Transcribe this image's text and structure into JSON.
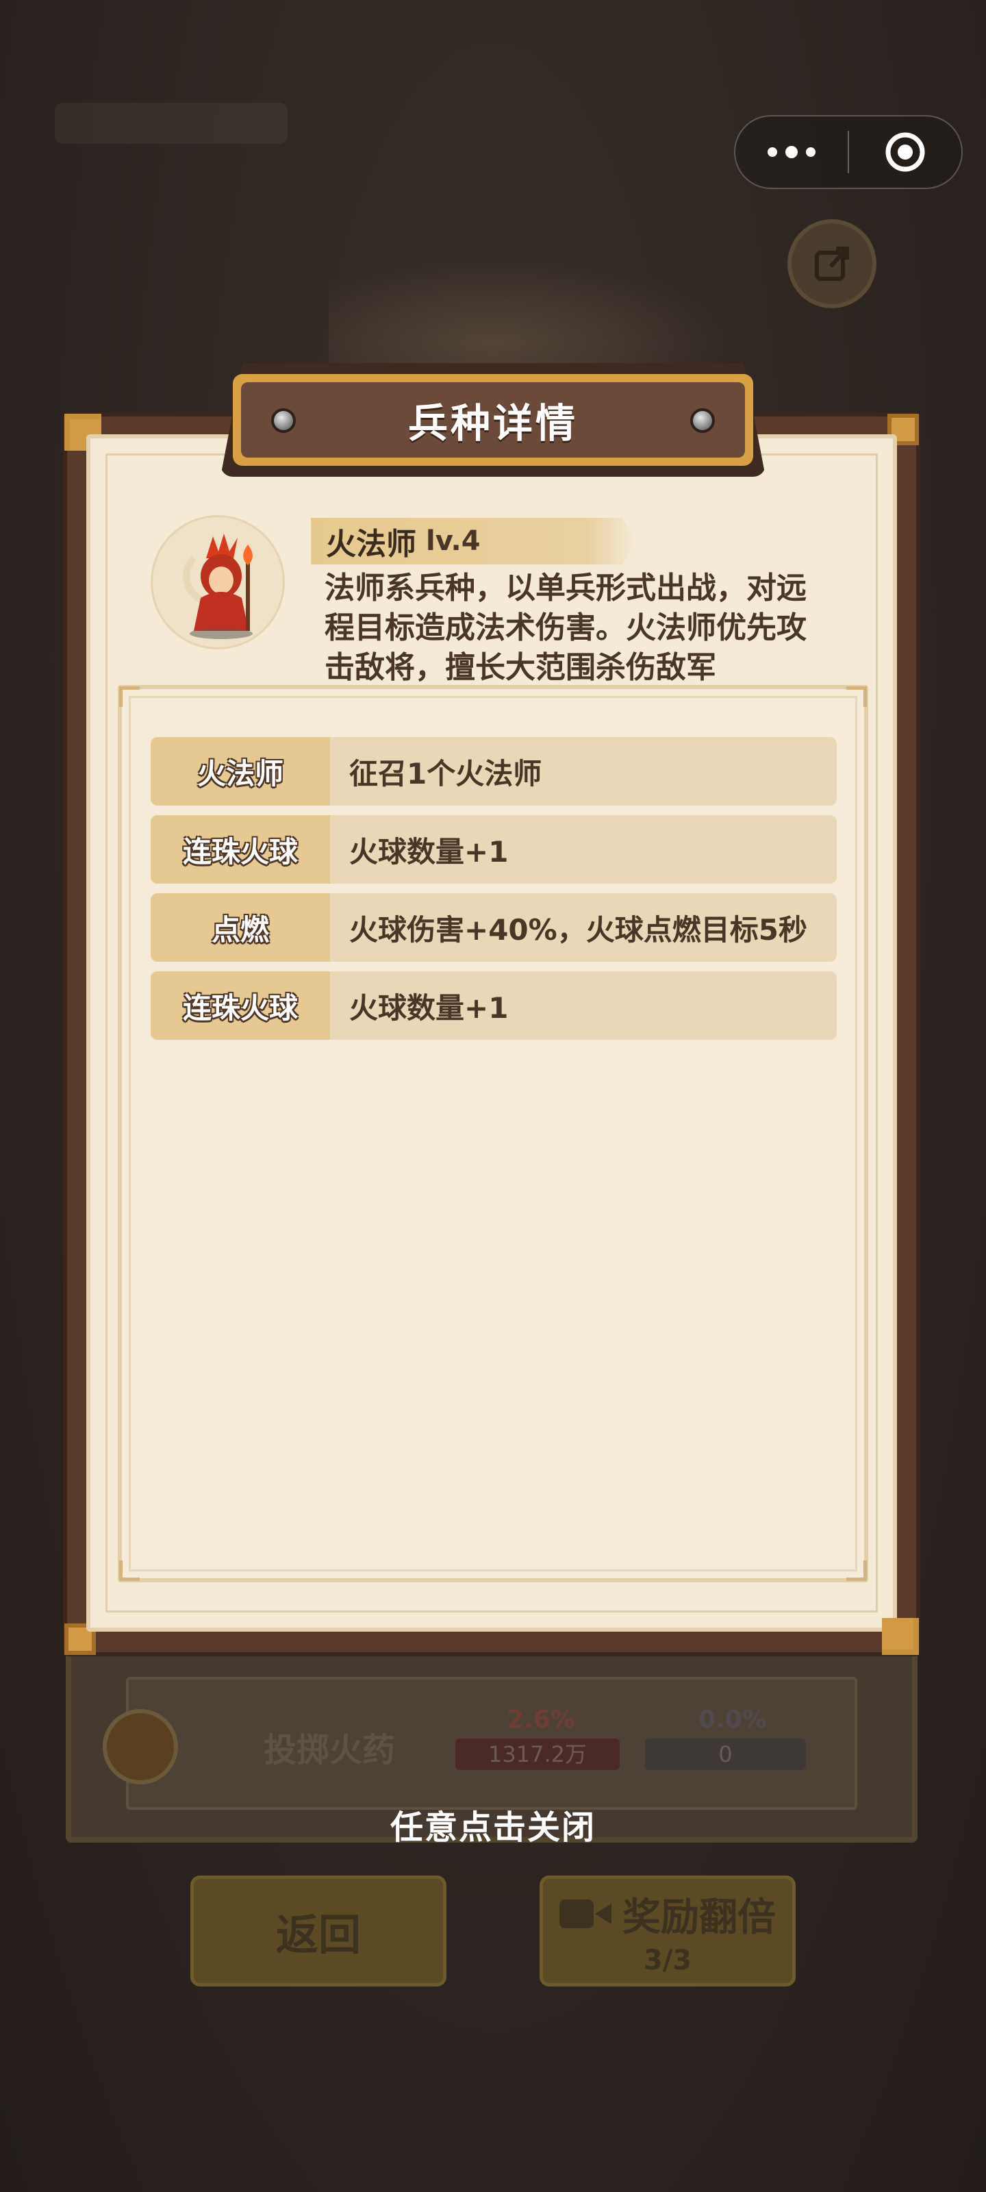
{
  "mini_program_capsule": {
    "more_icon": "more-dots-icon",
    "close_icon": "target-close-icon"
  },
  "background": {
    "share_icon": "share-icon",
    "skill_card": {
      "name": "投掷火药",
      "attack_stat": "2.6%",
      "defense_stat": "0.0%",
      "attack_value": "1317.2万",
      "defense_value": "0"
    },
    "buttons": {
      "back_label": "返回",
      "double_label": "奖励翻倍",
      "double_count": "3/3"
    }
  },
  "modal": {
    "title": "兵种详情",
    "unit": {
      "name": "火法师",
      "level": "lv.4",
      "description": "法师系兵种，以单兵形式出战，对远程目标造成法术伤害。火法师优先攻击敌将，擅长大范围杀伤敌军"
    },
    "upgrades": [
      {
        "key": "火法师",
        "value": "征召1个火法师"
      },
      {
        "key": "连珠火球",
        "value": "火球数量+1"
      },
      {
        "key": "点燃",
        "value": "火球伤害+40%，火球点燃目标5秒"
      },
      {
        "key": "连珠火球",
        "value": "火球数量+1"
      }
    ]
  },
  "close_hint": "任意点击关闭",
  "colors": {
    "parchment": "#f4ead6",
    "frame_brown": "#5a3a2a",
    "gold": "#d9a046",
    "row_key_bg": "#e6c992",
    "row_bg": "#ead7b8",
    "text_dark": "#4a3626"
  }
}
